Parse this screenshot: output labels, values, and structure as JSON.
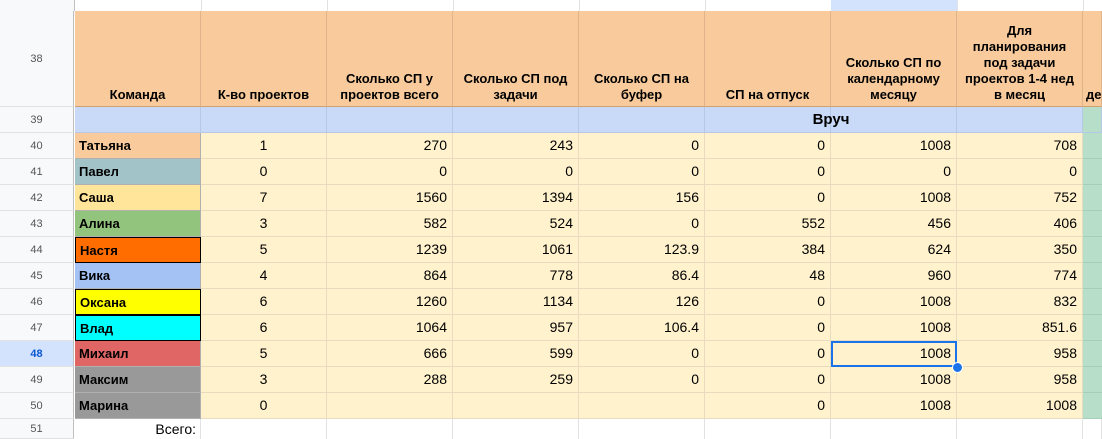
{
  "header": {
    "row_number": "38",
    "columns": [
      "Команда",
      "К-во проектов",
      "Сколько СП у проектов всего",
      "Сколько СП под задачи",
      "Сколько СП на буфер",
      "СП на отпуск",
      "Сколько СП по календарному месяцу",
      "Для планирования под задачи проектов 1-4 нед в месяц",
      "де"
    ]
  },
  "band_row": {
    "row_number": "39",
    "label": "Вруч"
  },
  "rows": [
    {
      "rn": "40",
      "name": "Татьяна",
      "color": "#f9cb9c",
      "boxed": false,
      "values": [
        "1",
        "270",
        "243",
        "0",
        "0",
        "1008",
        "708"
      ]
    },
    {
      "rn": "41",
      "name": "Павел",
      "color": "#a2c4c9",
      "boxed": false,
      "values": [
        "0",
        "0",
        "0",
        "0",
        "0",
        "0",
        "0"
      ]
    },
    {
      "rn": "42",
      "name": "Саша",
      "color": "#ffe599",
      "boxed": false,
      "values": [
        "7",
        "1560",
        "1394",
        "156",
        "0",
        "1008",
        "752"
      ]
    },
    {
      "rn": "43",
      "name": "Алина",
      "color": "#93c47d",
      "boxed": false,
      "values": [
        "3",
        "582",
        "524",
        "0",
        "552",
        "456",
        "406"
      ]
    },
    {
      "rn": "44",
      "name": "Настя",
      "color": "#ff6d01",
      "boxed": true,
      "values": [
        "5",
        "1239",
        "1061",
        "123.9",
        "384",
        "624",
        "350"
      ]
    },
    {
      "rn": "45",
      "name": "Вика",
      "color": "#a4c2f4",
      "boxed": false,
      "values": [
        "4",
        "864",
        "778",
        "86.4",
        "48",
        "960",
        "774"
      ]
    },
    {
      "rn": "46",
      "name": "Оксана",
      "color": "#ffff00",
      "boxed": true,
      "values": [
        "6",
        "1260",
        "1134",
        "126",
        "0",
        "1008",
        "832"
      ]
    },
    {
      "rn": "47",
      "name": "Влад",
      "color": "#00ffff",
      "boxed": true,
      "values": [
        "6",
        "1064",
        "957",
        "106.4",
        "0",
        "1008",
        "851.6"
      ]
    },
    {
      "rn": "48",
      "name": "Михаил",
      "color": "#e06666",
      "boxed": false,
      "values": [
        "5",
        "666",
        "599",
        "0",
        "0",
        "1008",
        "958"
      ]
    },
    {
      "rn": "49",
      "name": "Максим",
      "color": "#999999",
      "boxed": false,
      "values": [
        "3",
        "288",
        "259",
        "0",
        "0",
        "1008",
        "958"
      ]
    },
    {
      "rn": "50",
      "name": "Марина",
      "color": "#999999",
      "boxed": false,
      "values": [
        "0",
        "",
        "",
        "",
        "0",
        "1008",
        "1008"
      ]
    }
  ],
  "total_row": {
    "row_number": "51",
    "label": "Всего:"
  },
  "selection": {
    "row": "48",
    "column": "Сколько СП по календарному месяцу"
  },
  "colors": {
    "header_bg": "#f9cb9c",
    "data_bg": "#fff2cc",
    "band_bg": "#c9daf8",
    "selection": "#1a73e8",
    "edge_green": "#b6dec9"
  }
}
